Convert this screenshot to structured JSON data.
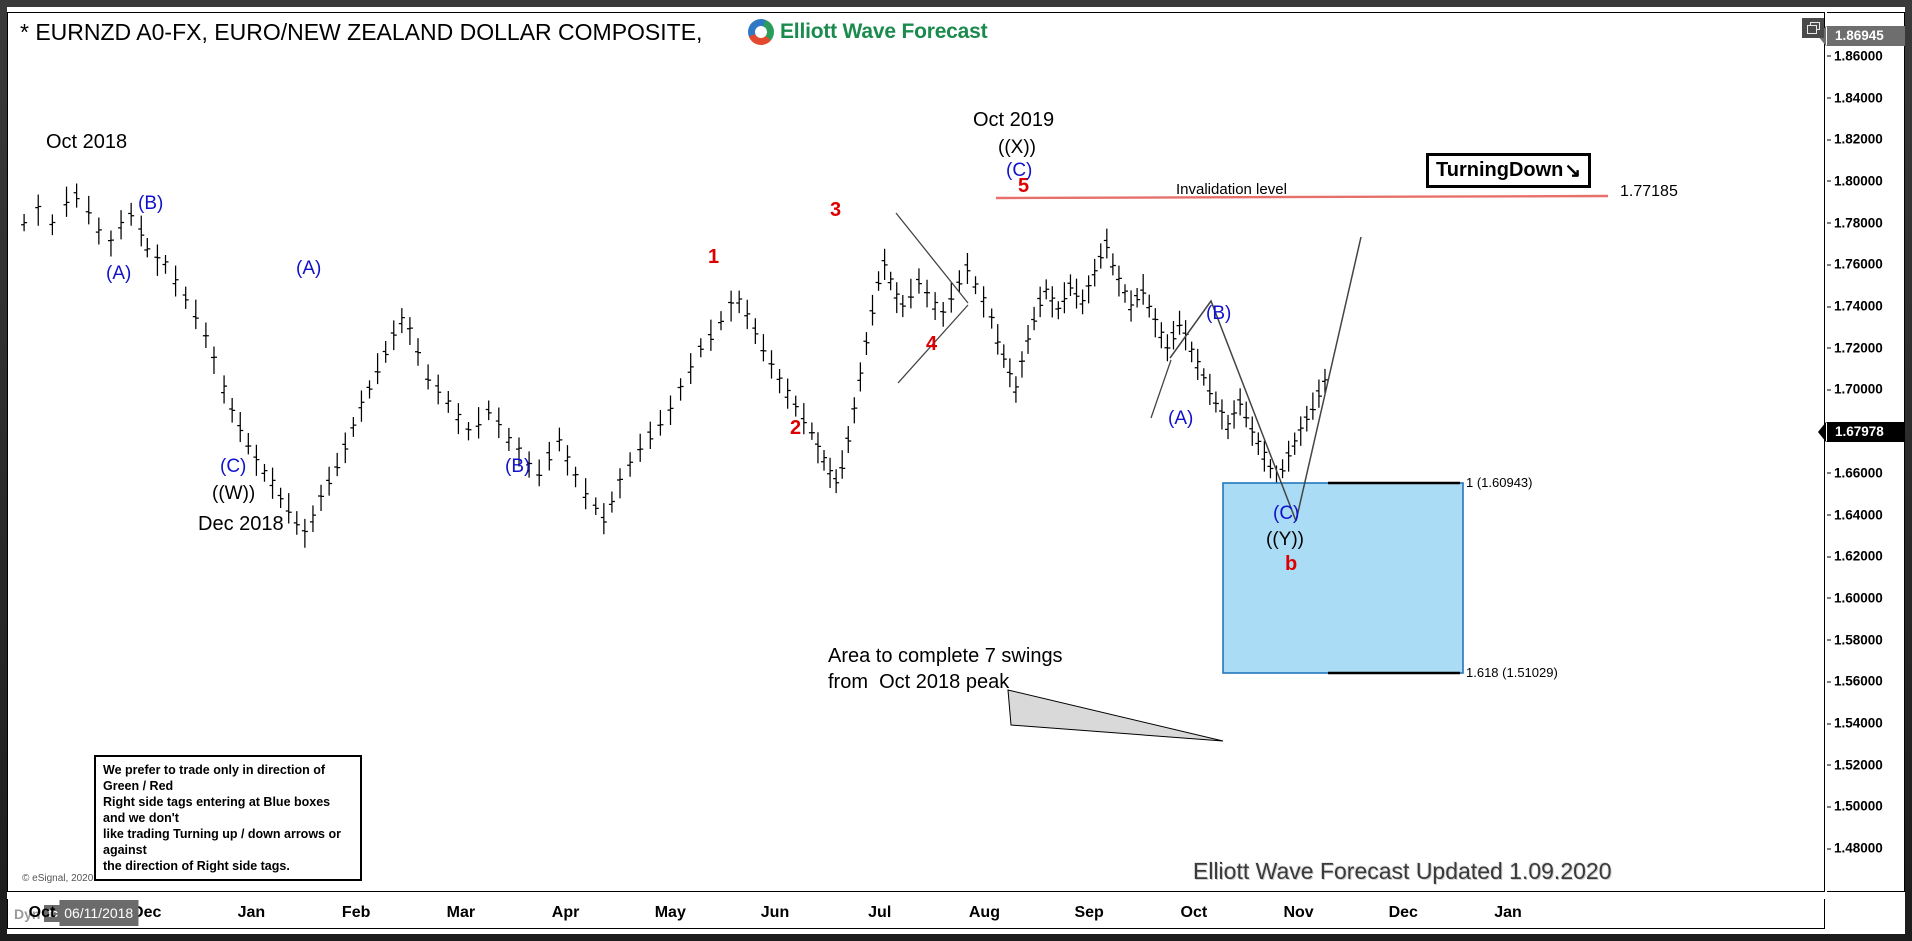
{
  "window": {
    "restore_icon": "restore-window-icon"
  },
  "header": {
    "title": "* EURNZD A0-FX, EURO/NEW ZEALAND DOLLAR COMPOSITE,",
    "brand_name": "Elliott Wave Forecast",
    "brand_logo_icon": "elliott-wave-swirl-logo-icon"
  },
  "footer": {
    "copyright": "© eSignal, 2020",
    "watermark": "Elliott Wave Forecast Updated 1.09.2020",
    "dyn_label": "Dyn",
    "dyn_icon": "dynamic-scale-icon"
  },
  "price_axis": {
    "ticks": [
      "1.86000",
      "1.84000",
      "1.82000",
      "1.80000",
      "1.78000",
      "1.76000",
      "1.74000",
      "1.72000",
      "1.70000",
      "1.66000",
      "1.64000",
      "1.62000",
      "1.60000",
      "1.58000",
      "1.56000",
      "1.54000",
      "1.52000",
      "1.50000",
      "1.48000"
    ],
    "high_marker": "1.86945",
    "last_marker": "1.67978",
    "high_marker_color": "#6e6e6e",
    "last_marker_color": "#000000"
  },
  "time_axis": {
    "ticks": [
      "Oct",
      "Dec",
      "Jan",
      "Feb",
      "Mar",
      "Apr",
      "May",
      "Jun",
      "Jul",
      "Aug",
      "Sep",
      "Oct",
      "Nov",
      "Dec",
      "Jan"
    ],
    "highlighted": "06/11/2018"
  },
  "annotations": {
    "oct_2018": "Oct 2018",
    "dec_2018": "Dec 2018",
    "oct_2019": "Oct 2019",
    "wave_a1": "(A)",
    "wave_b1": "(B)",
    "wave_a2": "(A)",
    "wave_c1": "(C)",
    "wave_w": "((W))",
    "wave_b2": "(B)",
    "wave_x": "((X))",
    "wave_c2": "(C)",
    "wave_a3": "(A)",
    "wave_b3": "(B)",
    "wave_c3": "(C)",
    "wave_y": "((Y))",
    "wave_b_red": "b",
    "imp_1": "1",
    "imp_2": "2",
    "imp_3": "3",
    "imp_4": "4",
    "imp_5": "5",
    "invalidation_label": "Invalidation level",
    "invalidation_price": "1.77185",
    "turning_down": "TurningDown",
    "turning_down_arrow": "↘",
    "area_note": "Area to complete 7 swings\nfrom  Oct 2018 peak",
    "fib_top": "1 (1.60943)",
    "fib_bottom": "1.618 (1.51029)",
    "disclaimer": "We prefer to trade only in direction of Green / Red\nRight side tags entering at Blue boxes and we don't\nlike trading Turning up / down arrows or against\nthe direction of Right side tags."
  },
  "colors": {
    "wave_blue": "#1111cc",
    "wave_red": "#dd0000",
    "invalidation_line": "#e8706b",
    "blue_box_fill": "#aadcf5",
    "blue_box_border": "#2277bb",
    "bar_color": "#000000"
  },
  "chart_data": {
    "type": "line",
    "title": "EURNZD A0-FX, EURO/NEW ZEALAND DOLLAR COMPOSITE",
    "xlabel": "",
    "ylabel": "",
    "ylim": [
      1.47,
      1.87
    ],
    "grid": false,
    "legend": "none",
    "series_name": "EURNZD OHLC bars (daily)",
    "x_tick_labels": [
      "Oct",
      "Dec",
      "Jan",
      "Feb",
      "Mar",
      "Apr",
      "May",
      "Jun",
      "Jul",
      "Aug",
      "Sep",
      "Oct",
      "Nov",
      "Dec",
      "Jan"
    ],
    "y_tick_values": [
      1.86,
      1.84,
      1.82,
      1.8,
      1.78,
      1.76,
      1.74,
      1.72,
      1.7,
      1.66,
      1.64,
      1.62,
      1.6,
      1.58,
      1.56,
      1.54,
      1.52,
      1.5,
      1.48
    ],
    "current_price": 1.67978,
    "period_high": 1.86945,
    "invalidation_level": 1.77185,
    "fib_targets": [
      {
        "label": "1",
        "value": 1.60943
      },
      {
        "label": "1.618",
        "value": 1.51029
      }
    ],
    "pivots": [
      {
        "label": "Oct 2018",
        "price": 1.7925,
        "note": "peak"
      },
      {
        "label": "(A)",
        "price": 1.725
      },
      {
        "label": "(B)",
        "price": 1.768
      },
      {
        "label": "(C) ((W)) Dec 2018",
        "price": 1.63
      },
      {
        "label": "(A)",
        "price": 1.735
      },
      {
        "label": "(B)",
        "price": 1.631
      },
      {
        "label": "1",
        "price": 1.742
      },
      {
        "label": "2",
        "price": 1.656
      },
      {
        "label": "3",
        "price": 1.765
      },
      {
        "label": "4",
        "price": 1.7
      },
      {
        "label": "5 (C) ((X)) Oct 2019",
        "price": 1.7718
      },
      {
        "label": "(A)",
        "price": 1.663
      },
      {
        "label": "(B)",
        "price": 1.706
      },
      {
        "label": "(C) ((Y)) b",
        "price": 1.57,
        "note": "projected into blue box"
      }
    ],
    "blue_box": {
      "top": 1.60943,
      "bottom": 1.51029,
      "label": "(C) ((Y)) b"
    }
  }
}
